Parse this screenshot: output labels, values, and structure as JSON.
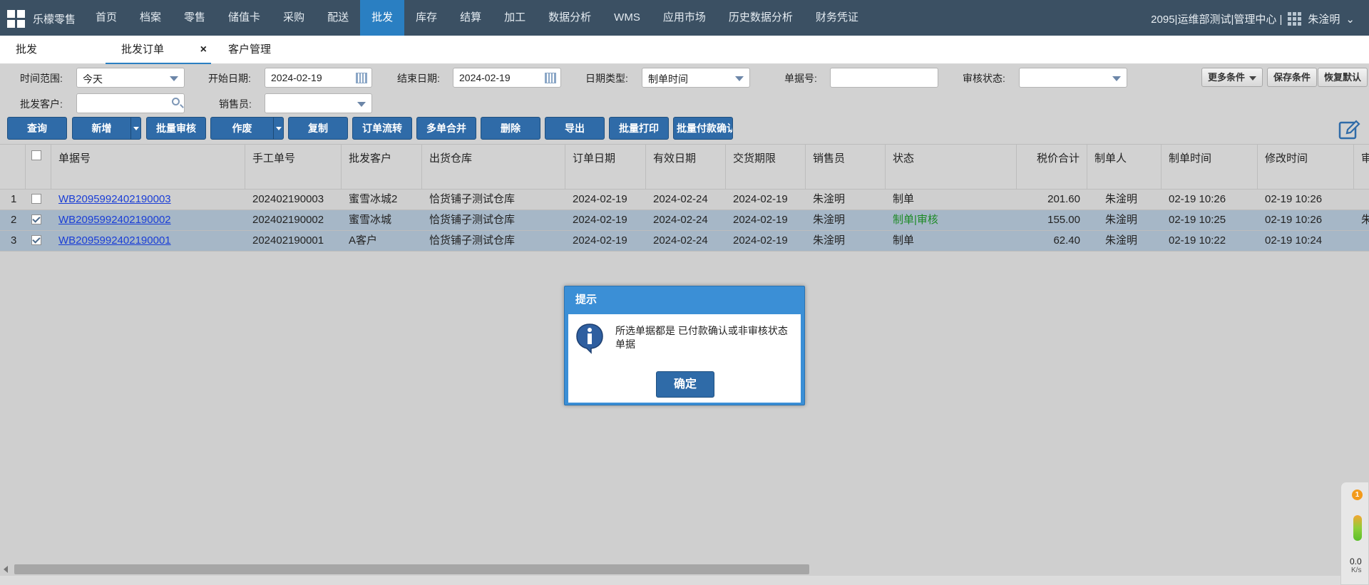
{
  "topbar": {
    "brand": "乐檬零售",
    "nav": [
      "首页",
      "档案",
      "零售",
      "储值卡",
      "采购",
      "配送",
      "批发",
      "库存",
      "结算",
      "加工",
      "数据分析",
      "WMS",
      "应用市场",
      "历史数据分析",
      "财务凭证"
    ],
    "active_nav": "批发",
    "org": "2095|运维部测试|管理中心 |",
    "user": "朱淦明",
    "user_caret": "⌄"
  },
  "tabs": [
    {
      "label": "批发"
    },
    {
      "label": "批发订单",
      "close": "×"
    },
    {
      "label": "客户管理"
    }
  ],
  "filters": {
    "time_range_label": "时间范围:",
    "time_range_value": "今天",
    "start_date_label": "开始日期:",
    "start_date_value": "2024-02-19",
    "end_date_label": "结束日期:",
    "end_date_value": "2024-02-19",
    "date_type_label": "日期类型:",
    "date_type_value": "制单时间",
    "doc_no_label": "单据号:",
    "doc_no_value": "",
    "audit_status_label": "审核状态:",
    "audit_status_value": "",
    "customer_label": "批发客户:",
    "customer_value": "",
    "salesman_label": "销售员:",
    "salesman_value": "",
    "more_conditions": "更多条件",
    "save_conditions": "保存条件",
    "restore_default": "恢复默认"
  },
  "toolbar": {
    "query": "查询",
    "add": "新增",
    "batch_audit": "批量审核",
    "void": "作废",
    "copy": "复制",
    "order_flow": "订单流转",
    "merge": "多单合并",
    "delete": "删除",
    "export": "导出",
    "batch_print": "批量打印",
    "batch_payment": "批量付款确认"
  },
  "grid": {
    "headers": {
      "doc_no": "单据号",
      "manual_no": "手工单号",
      "customer": "批发客户",
      "warehouse": "出货仓库",
      "order_date": "订单日期",
      "valid_date": "有效日期",
      "delivery_date": "交货期限",
      "salesman": "销售员",
      "status": "状态",
      "total": "税价合计",
      "creator": "制单人",
      "created_time": "制单时间",
      "modified_time": "修改时间",
      "auditor": "审"
    },
    "rows": [
      {
        "idx": "1",
        "doc_no": "WB2095992402190003",
        "manual_no": "202402190003",
        "customer": "蜜雪冰城2",
        "warehouse": "恰货铺子测试仓库",
        "order_date": "2024-02-19",
        "valid_date": "2024-02-24",
        "delivery_date": "2024-02-19",
        "salesman": "朱淦明",
        "status": "制单",
        "total": "201.60",
        "creator": "朱淦明",
        "created_time": "02-19 10:26",
        "modified_time": "02-19 10:26",
        "auditor": "",
        "checked": false,
        "selected": false
      },
      {
        "idx": "2",
        "doc_no": "WB2095992402190002",
        "manual_no": "202402190002",
        "customer": "蜜雪冰城",
        "warehouse": "恰货铺子测试仓库",
        "order_date": "2024-02-19",
        "valid_date": "2024-02-24",
        "delivery_date": "2024-02-19",
        "salesman": "朱淦明",
        "status": "制单|审核",
        "total": "155.00",
        "creator": "朱淦明",
        "created_time": "02-19 10:25",
        "modified_time": "02-19 10:26",
        "auditor": "朱",
        "checked": true,
        "selected": true
      },
      {
        "idx": "3",
        "doc_no": "WB2095992402190001",
        "manual_no": "202402190001",
        "customer": "A客户",
        "warehouse": "恰货铺子测试仓库",
        "order_date": "2024-02-19",
        "valid_date": "2024-02-24",
        "delivery_date": "2024-02-19",
        "salesman": "朱淦明",
        "status": "制单",
        "total": "62.40",
        "creator": "朱淦明",
        "created_time": "02-19 10:22",
        "modified_time": "02-19 10:24",
        "auditor": "",
        "checked": true,
        "selected": true
      }
    ]
  },
  "dialog": {
    "title": "提示",
    "message": "所选单据都是 已付款确认或非审核状态 单据",
    "ok": "确定"
  },
  "widget": {
    "badge": "1",
    "value": "0.0",
    "unit": "K/s"
  },
  "colors": {
    "topbar": "#3b5063",
    "active_nav": "#2a7fc2",
    "button": "#2f6ba8",
    "selected_row": "#a6b7c7",
    "status_green": "#1c8a25",
    "dialog_header": "#3b8fd6"
  }
}
